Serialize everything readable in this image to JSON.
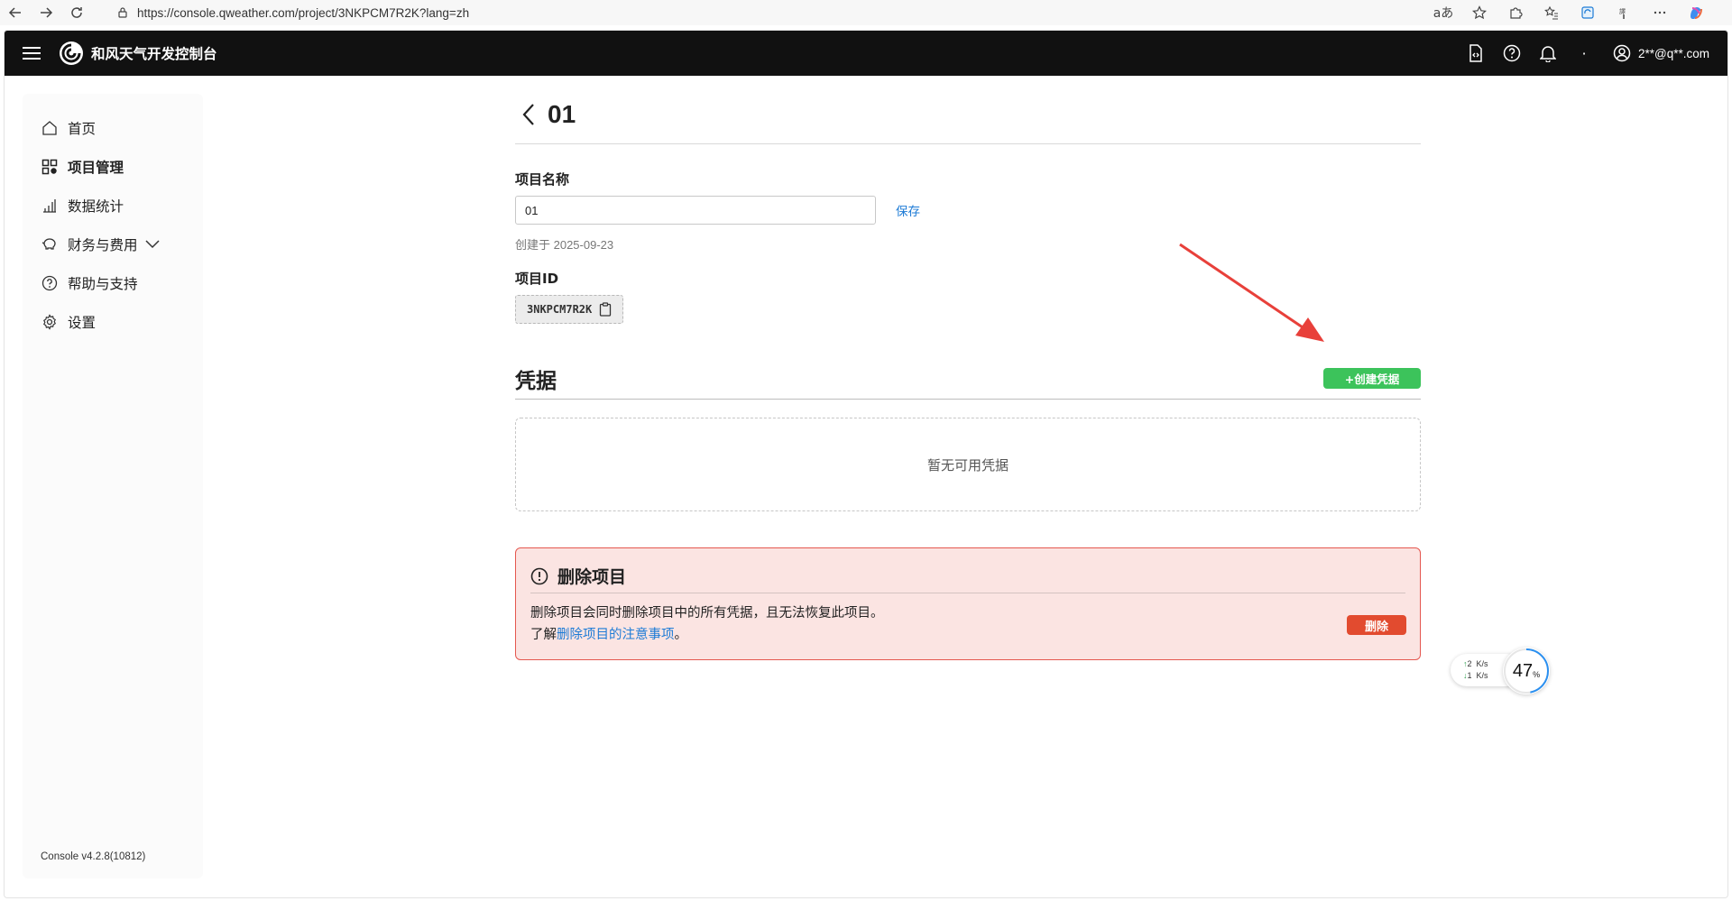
{
  "browser": {
    "url": "https://console.qweather.com/project/3NKPCM7R2K?lang=zh",
    "read_aloud_label": "aあ"
  },
  "app": {
    "brand": "和风天气开发控制台",
    "user": "2**@q**.com",
    "dot": "·"
  },
  "sidebar": {
    "items": [
      {
        "label": "首页",
        "icon": "home-icon"
      },
      {
        "label": "项目管理",
        "icon": "grid-icon"
      },
      {
        "label": "数据统计",
        "icon": "bar-chart-icon"
      },
      {
        "label": "财务与费用",
        "icon": "piggy-bank-icon"
      },
      {
        "label": "帮助与支持",
        "icon": "help-circle-icon"
      },
      {
        "label": "设置",
        "icon": "gear-icon"
      }
    ],
    "version": "Console v4.2.8(10812)"
  },
  "project": {
    "title": "01",
    "name_label": "项目名称",
    "name_value": "01",
    "save_label": "保存",
    "created": "创建于 2025-09-23",
    "id_label": "项目ID",
    "id_value": "3NKPCM7R2K"
  },
  "credentials": {
    "title": "凭据",
    "create_label": "+创建凭据",
    "empty_text": "暂无可用凭据"
  },
  "danger": {
    "title": "删除项目",
    "text1": "删除项目会同时删除项目中的所有凭据，且无法恢复此项目。",
    "text2_prefix": "了解",
    "text2_link": "删除项目的注意事项",
    "text2_suffix": "。",
    "delete_label": "删除"
  },
  "net_widget": {
    "up": "2",
    "down": "1",
    "unit": "K/s",
    "percent": "47",
    "percent_unit": "%"
  },
  "colors": {
    "topbar": "#111111",
    "accent_green": "#3cc35b",
    "danger_red": "#e24b2f",
    "link_blue": "#1d7bd6",
    "annotation_arrow": "#e8403a"
  }
}
